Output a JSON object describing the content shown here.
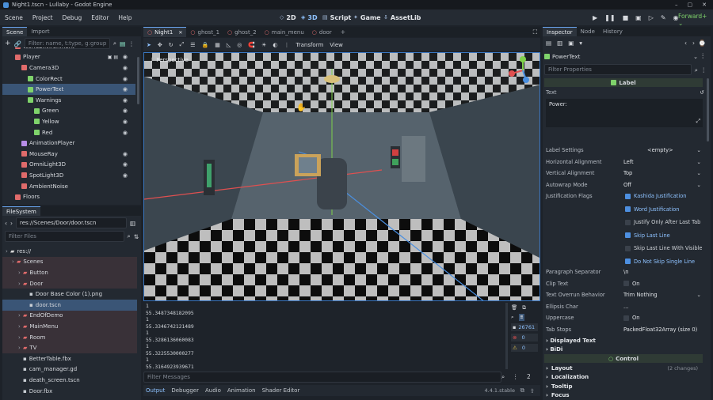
{
  "window": {
    "title": "Night1.tscn - Lullaby - Godot Engine"
  },
  "menubar": {
    "items": [
      "Scene",
      "Project",
      "Debug",
      "Editor",
      "Help"
    ]
  },
  "workspaces": [
    {
      "label": "2D",
      "glyph": "◇"
    },
    {
      "label": "3D",
      "glyph": "◈"
    },
    {
      "label": "Script",
      "glyph": "▤"
    },
    {
      "label": "Game",
      "glyph": "✦"
    },
    {
      "label": "AssetLib",
      "glyph": "⇩"
    }
  ],
  "renderer": "Forward+",
  "scene_dock": {
    "tabs": [
      "Scene",
      "Import"
    ],
    "filter_placeholder": "Filter: name, t:type, g:group",
    "nodes": [
      {
        "label": "WorldEnvironment",
        "indent": 2,
        "color": "#e06b6b",
        "eye": false,
        "extra": ""
      },
      {
        "label": "Player",
        "indent": 2,
        "color": "#e06b6b",
        "eye": true,
        "extra": "▣ ▤"
      },
      {
        "label": "Camera3D",
        "indent": 3,
        "color": "#e06b6b",
        "eye": true,
        "extra": ""
      },
      {
        "label": "ColorRect",
        "indent": 4,
        "color": "#7fd36b",
        "eye": true,
        "extra": ""
      },
      {
        "label": "PowerText",
        "indent": 4,
        "color": "#7fd36b",
        "eye": true,
        "extra": "",
        "selected": true
      },
      {
        "label": "Warnings",
        "indent": 4,
        "color": "#7fd36b",
        "eye": true,
        "extra": ""
      },
      {
        "label": "Green",
        "indent": 5,
        "color": "#7fd36b",
        "eye": true,
        "extra": ""
      },
      {
        "label": "Yellow",
        "indent": 5,
        "color": "#7fd36b",
        "eye": true,
        "extra": ""
      },
      {
        "label": "Red",
        "indent": 5,
        "color": "#7fd36b",
        "eye": true,
        "extra": ""
      },
      {
        "label": "AnimationPlayer",
        "indent": 3,
        "color": "#b78de8",
        "eye": false,
        "extra": ""
      },
      {
        "label": "MouseRay",
        "indent": 3,
        "color": "#e06b6b",
        "eye": true,
        "extra": ""
      },
      {
        "label": "OmniLight3D",
        "indent": 3,
        "color": "#e06b6b",
        "eye": true,
        "extra": ""
      },
      {
        "label": "SpotLight3D",
        "indent": 3,
        "color": "#e06b6b",
        "eye": true,
        "extra": ""
      },
      {
        "label": "AmbientNoise",
        "indent": 3,
        "color": "#e06b6b",
        "eye": false,
        "extra": ""
      },
      {
        "label": "Floors",
        "indent": 2,
        "color": "#e06b6b",
        "eye": false,
        "extra": ""
      }
    ]
  },
  "filesystem": {
    "title": "FileSystem",
    "path": "res://Scenes/Door/door.tscn",
    "filter_placeholder": "Filter Files",
    "items": [
      {
        "label": "res://",
        "indent": 0,
        "type": "folder",
        "color": "#d8d8d8"
      },
      {
        "label": "Scenes",
        "indent": 1,
        "type": "folder",
        "color": "#e06b6b",
        "hl": true
      },
      {
        "label": "Button",
        "indent": 2,
        "type": "folder",
        "color": "#e06b6b",
        "hl": true
      },
      {
        "label": "Door",
        "indent": 2,
        "type": "folder",
        "color": "#e06b6b",
        "hl": true
      },
      {
        "label": "Door Base Color (1).png",
        "indent": 3,
        "type": "file",
        "color": "#c9ced4"
      },
      {
        "label": "door.tscn",
        "indent": 3,
        "type": "file",
        "color": "#c9ced4",
        "selected": true
      },
      {
        "label": "EndOfDemo",
        "indent": 2,
        "type": "folder",
        "color": "#e06b6b",
        "hl": true
      },
      {
        "label": "MainMenu",
        "indent": 2,
        "type": "folder",
        "color": "#e06b6b",
        "hl": true
      },
      {
        "label": "Room",
        "indent": 2,
        "type": "folder",
        "color": "#e06b6b",
        "hl": true
      },
      {
        "label": "TV",
        "indent": 2,
        "type": "folder",
        "color": "#e06b6b",
        "hl": true
      },
      {
        "label": "BetterTable.fbx",
        "indent": 2,
        "type": "file",
        "color": "#c9ced4"
      },
      {
        "label": "cam_manager.gd",
        "indent": 2,
        "type": "file",
        "color": "#c9ced4"
      },
      {
        "label": "death_screen.tscn",
        "indent": 2,
        "type": "file",
        "color": "#c9ced4"
      },
      {
        "label": "Door.fbx",
        "indent": 2,
        "type": "file",
        "color": "#c9ced4"
      }
    ]
  },
  "editor_tabs": [
    {
      "label": "Night1",
      "color": "#e06b6b",
      "active": true
    },
    {
      "label": "ghost_1",
      "color": "#e06b6b"
    },
    {
      "label": "ghost_2",
      "color": "#e06b6b"
    },
    {
      "label": "main_menu",
      "color": "#e06b6b"
    },
    {
      "label": "door",
      "color": "#e06b6b"
    }
  ],
  "viewport": {
    "toolbar": {
      "transform": "Transform",
      "view": "View"
    },
    "label": "Perspective"
  },
  "output": {
    "lines": [
      "1",
      "55.3487348182095",
      "1",
      "55.3346742121489",
      "1",
      "55.3286136060083",
      "1",
      "55.3225530000277",
      "1",
      "55.3164923939671",
      "1"
    ],
    "filter_placeholder": "Filter Messages",
    "counts": {
      "log": "26761",
      "errors": "0",
      "warnings": "0"
    },
    "page": "2"
  },
  "bottom_tabs": [
    "Output",
    "Debugger",
    "Audio",
    "Animation",
    "Shader Editor"
  ],
  "version": "4.4.1.stable",
  "inspector": {
    "tabs": [
      "Inspector",
      "Node",
      "History"
    ],
    "node_name": "PowerText",
    "filter_placeholder": "Filter Properties",
    "class_header": "Label",
    "text_label": "Text",
    "text_value": "Power:",
    "properties": [
      {
        "label": "Label Settings",
        "value": "<empty>",
        "kind": "resource"
      },
      {
        "label": "Horizontal Alignment",
        "value": "Left",
        "kind": "enum"
      },
      {
        "label": "Vertical Alignment",
        "value": "Top",
        "kind": "enum"
      },
      {
        "label": "Autowrap Mode",
        "value": "Off",
        "kind": "enum"
      }
    ],
    "justification": {
      "label": "Justification Flags",
      "flags": [
        {
          "label": "Kashida Justification",
          "on": true
        },
        {
          "label": "Word Justification",
          "on": true
        },
        {
          "label": "Justify Only After Last Tab",
          "on": false
        },
        {
          "label": "Skip Last Line",
          "on": true
        },
        {
          "label": "Skip Last Line With Visible",
          "on": false
        },
        {
          "label": "Do Not Skip Single Line",
          "on": true
        }
      ]
    },
    "properties2": [
      {
        "label": "Paragraph Separator",
        "value": "\\n",
        "kind": "text"
      },
      {
        "label": "Clip Text",
        "value": "On",
        "kind": "check"
      },
      {
        "label": "Text Overrun Behavior",
        "value": "Trim Nothing",
        "kind": "enum"
      },
      {
        "label": "Ellipsis Char",
        "value": "...",
        "kind": "text"
      },
      {
        "label": "Uppercase",
        "value": "On",
        "kind": "check"
      },
      {
        "label": "Tab Stops",
        "value": "PackedFloat32Array (size 0)",
        "kind": "text"
      }
    ],
    "sections": [
      "Displayed Text",
      "BiDi"
    ],
    "control_header": "Control",
    "control_sections": [
      {
        "label": "Layout",
        "note": "(2 changes)"
      },
      {
        "label": "Localization",
        "note": ""
      },
      {
        "label": "Tooltip",
        "note": ""
      },
      {
        "label": "Focus",
        "note": ""
      }
    ]
  }
}
